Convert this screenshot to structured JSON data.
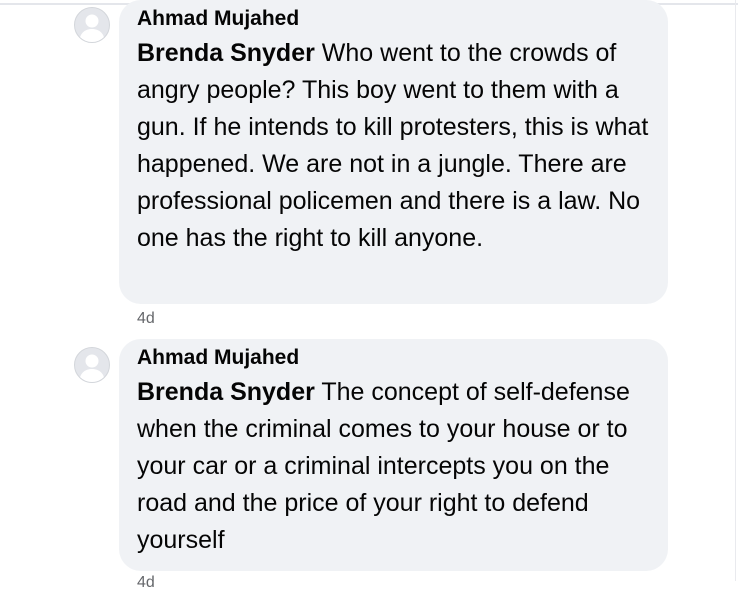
{
  "comments": [
    {
      "author": "Ahmad Mujahed",
      "mention": "Brenda Snyder",
      "text": " Who went to the crowds of angry people? This boy went to them with a gun. If he intends to kill protesters, this is what happened. We are not in a jungle. There are professional policemen and there is a law. No one has the right to kill anyone.",
      "time": "4d",
      "avatar_icon": "default-avatar-icon"
    },
    {
      "author": "Ahmad Mujahed",
      "mention": "Brenda Snyder",
      "text": " The concept of self-defense when the criminal comes to your house or to your car or a criminal intercepts you on the road and the price of your right to defend yourself",
      "time": "4d",
      "avatar_icon": "default-avatar-icon"
    }
  ],
  "colors": {
    "bubble": "#f0f2f5",
    "text": "#050505",
    "secondary": "#65676b"
  }
}
